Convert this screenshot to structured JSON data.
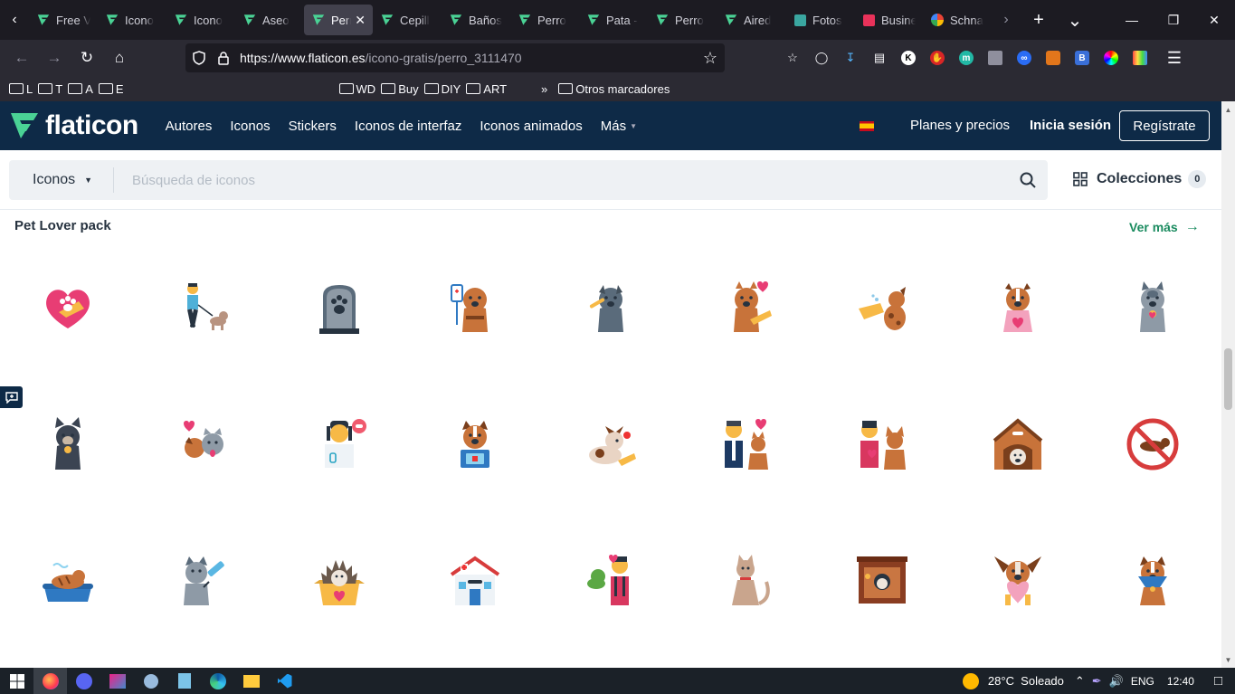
{
  "browser": {
    "tabs": [
      {
        "label": "Free V",
        "icon": "flaticon-favicon"
      },
      {
        "label": "Icono",
        "icon": "flaticon-favicon"
      },
      {
        "label": "Icono",
        "icon": "flaticon-favicon"
      },
      {
        "label": "Aseo",
        "icon": "flaticon-favicon"
      },
      {
        "label": "Perr",
        "icon": "flaticon-favicon",
        "active": true
      },
      {
        "label": "Cepill",
        "icon": "flaticon-favicon"
      },
      {
        "label": "Baños",
        "icon": "flaticon-favicon"
      },
      {
        "label": "Perro",
        "icon": "flaticon-favicon"
      },
      {
        "label": "Pata -",
        "icon": "flaticon-favicon"
      },
      {
        "label": "Perro",
        "icon": "flaticon-favicon"
      },
      {
        "label": "Aired",
        "icon": "flaticon-favicon"
      },
      {
        "label": "Fotos",
        "icon": "photos-favicon"
      },
      {
        "label": "Busine",
        "icon": "mail-favicon"
      },
      {
        "label": "Schna",
        "icon": "google-favicon"
      }
    ],
    "url": {
      "host": "https://www.flaticon.es",
      "path": "/icono-gratis/perro_3111470"
    },
    "bookmarks": [
      {
        "label": "L",
        "type": "folder"
      },
      {
        "label": "T",
        "type": "folder"
      },
      {
        "label": "A",
        "type": "folder"
      },
      {
        "label": "E",
        "type": "folder"
      },
      {
        "label": "WD",
        "type": "folder"
      },
      {
        "label": "Buy",
        "type": "folder"
      },
      {
        "label": "DIY",
        "type": "folder"
      },
      {
        "label": "ART",
        "type": "folder"
      },
      {
        "label": "Otros marcadores",
        "type": "folder"
      }
    ]
  },
  "site": {
    "logo_text": "flaticon",
    "nav": [
      "Autores",
      "Iconos",
      "Stickers",
      "Iconos de interfaz",
      "Iconos animados",
      "Más"
    ],
    "pricing_label": "Planes y precios",
    "login_label": "Inicia sesión",
    "register_label": "Regístrate"
  },
  "search": {
    "type_label": "Iconos",
    "placeholder": "Búsqueda de iconos",
    "collections_label": "Colecciones",
    "collections_count": "0"
  },
  "pack": {
    "title": "Pet Lover pack",
    "see_more": "Ver más",
    "icons": [
      "heart-paw-hand-icon",
      "dog-walker-icon",
      "pet-grave-icon",
      "dog-iv-drip-icon",
      "grey-dog-bone-icon",
      "cat-heart-hand-icon",
      "hand-feeding-dog-icon",
      "dog-apron-heart-icon",
      "grey-cat-bell-icon",
      "french-bulldog-icon",
      "dog-cat-love-icon",
      "vet-woman-icon",
      "dog-medical-kit-icon",
      "dog-lying-bone-icon",
      "man-cat-heart-icon",
      "woman-dog-heart-icon",
      "dog-house-icon",
      "no-pets-sign-icon",
      "dog-bathtub-icon",
      "dog-vaccine-icon",
      "hedgehog-box-icon",
      "pet-hospital-icon",
      "groomer-dog-icon",
      "sitting-cat-icon",
      "pet-fireplace-icon",
      "bunny-dog-heart-icon",
      "dog-cone-icon"
    ]
  },
  "taskbar": {
    "weather": "28°C  Soleado",
    "lang": "ENG",
    "time": "12:40"
  },
  "colors": {
    "header_bg": "#0e2a47",
    "accent_green": "#1a8b5f",
    "logo_green": "#4ad295"
  }
}
